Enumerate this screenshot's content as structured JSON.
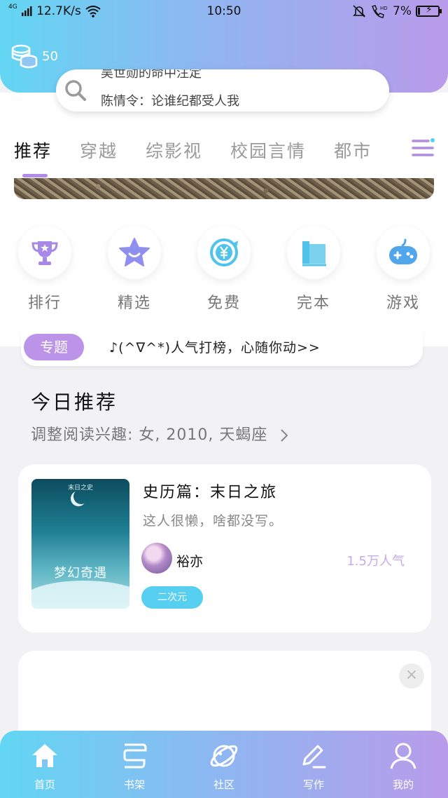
{
  "status_bar": {
    "network_type": "4G",
    "network_speed": "12.7K/s",
    "time": "10:50",
    "battery_percent": "7%",
    "battery_level": 0.07
  },
  "header": {
    "coins_count": "50"
  },
  "search": {
    "line1": "吴世勋的命中注定",
    "line2": "陈情令：论谁纪都受人我"
  },
  "tabs": [
    {
      "label": "推荐",
      "active": true
    },
    {
      "label": "穿越",
      "active": false
    },
    {
      "label": "综影视",
      "active": false
    },
    {
      "label": "校园言情",
      "active": false
    },
    {
      "label": "都市",
      "active": false
    }
  ],
  "categories": [
    {
      "label": "排行",
      "icon": "trophy-icon"
    },
    {
      "label": "精选",
      "icon": "star-icon"
    },
    {
      "label": "免费",
      "icon": "yuan-refresh-icon"
    },
    {
      "label": "完本",
      "icon": "book-icon"
    },
    {
      "label": "游戏",
      "icon": "gamepad-icon"
    }
  ],
  "topic": {
    "badge": "专题",
    "text": "♪(^∇^*)人气打榜，心随你动>>"
  },
  "today": {
    "title": "今日推荐",
    "subtitle": "调整阅读兴趣: 女, 2010, 天蝎座"
  },
  "book": {
    "cover_top_text": "末日之史",
    "cover_title": "梦幻奇遇",
    "title": "史历篇：末日之旅",
    "description": "这人很懒，啥都没写。",
    "author": "裕亦",
    "popularity": "1.5万人气",
    "tag": "二次元"
  },
  "ad": {
    "close_symbol": "×"
  },
  "bottom_nav": [
    {
      "label": "首页",
      "icon": "home-icon"
    },
    {
      "label": "书架",
      "icon": "bookshelf-icon"
    },
    {
      "label": "社区",
      "icon": "planet-icon"
    },
    {
      "label": "写作",
      "icon": "pen-icon"
    },
    {
      "label": "我的",
      "icon": "user-icon"
    }
  ],
  "colors": {
    "accent_purple": "#b18be6",
    "accent_blue": "#56cff0",
    "popularity_color": "#c3a9ee"
  }
}
